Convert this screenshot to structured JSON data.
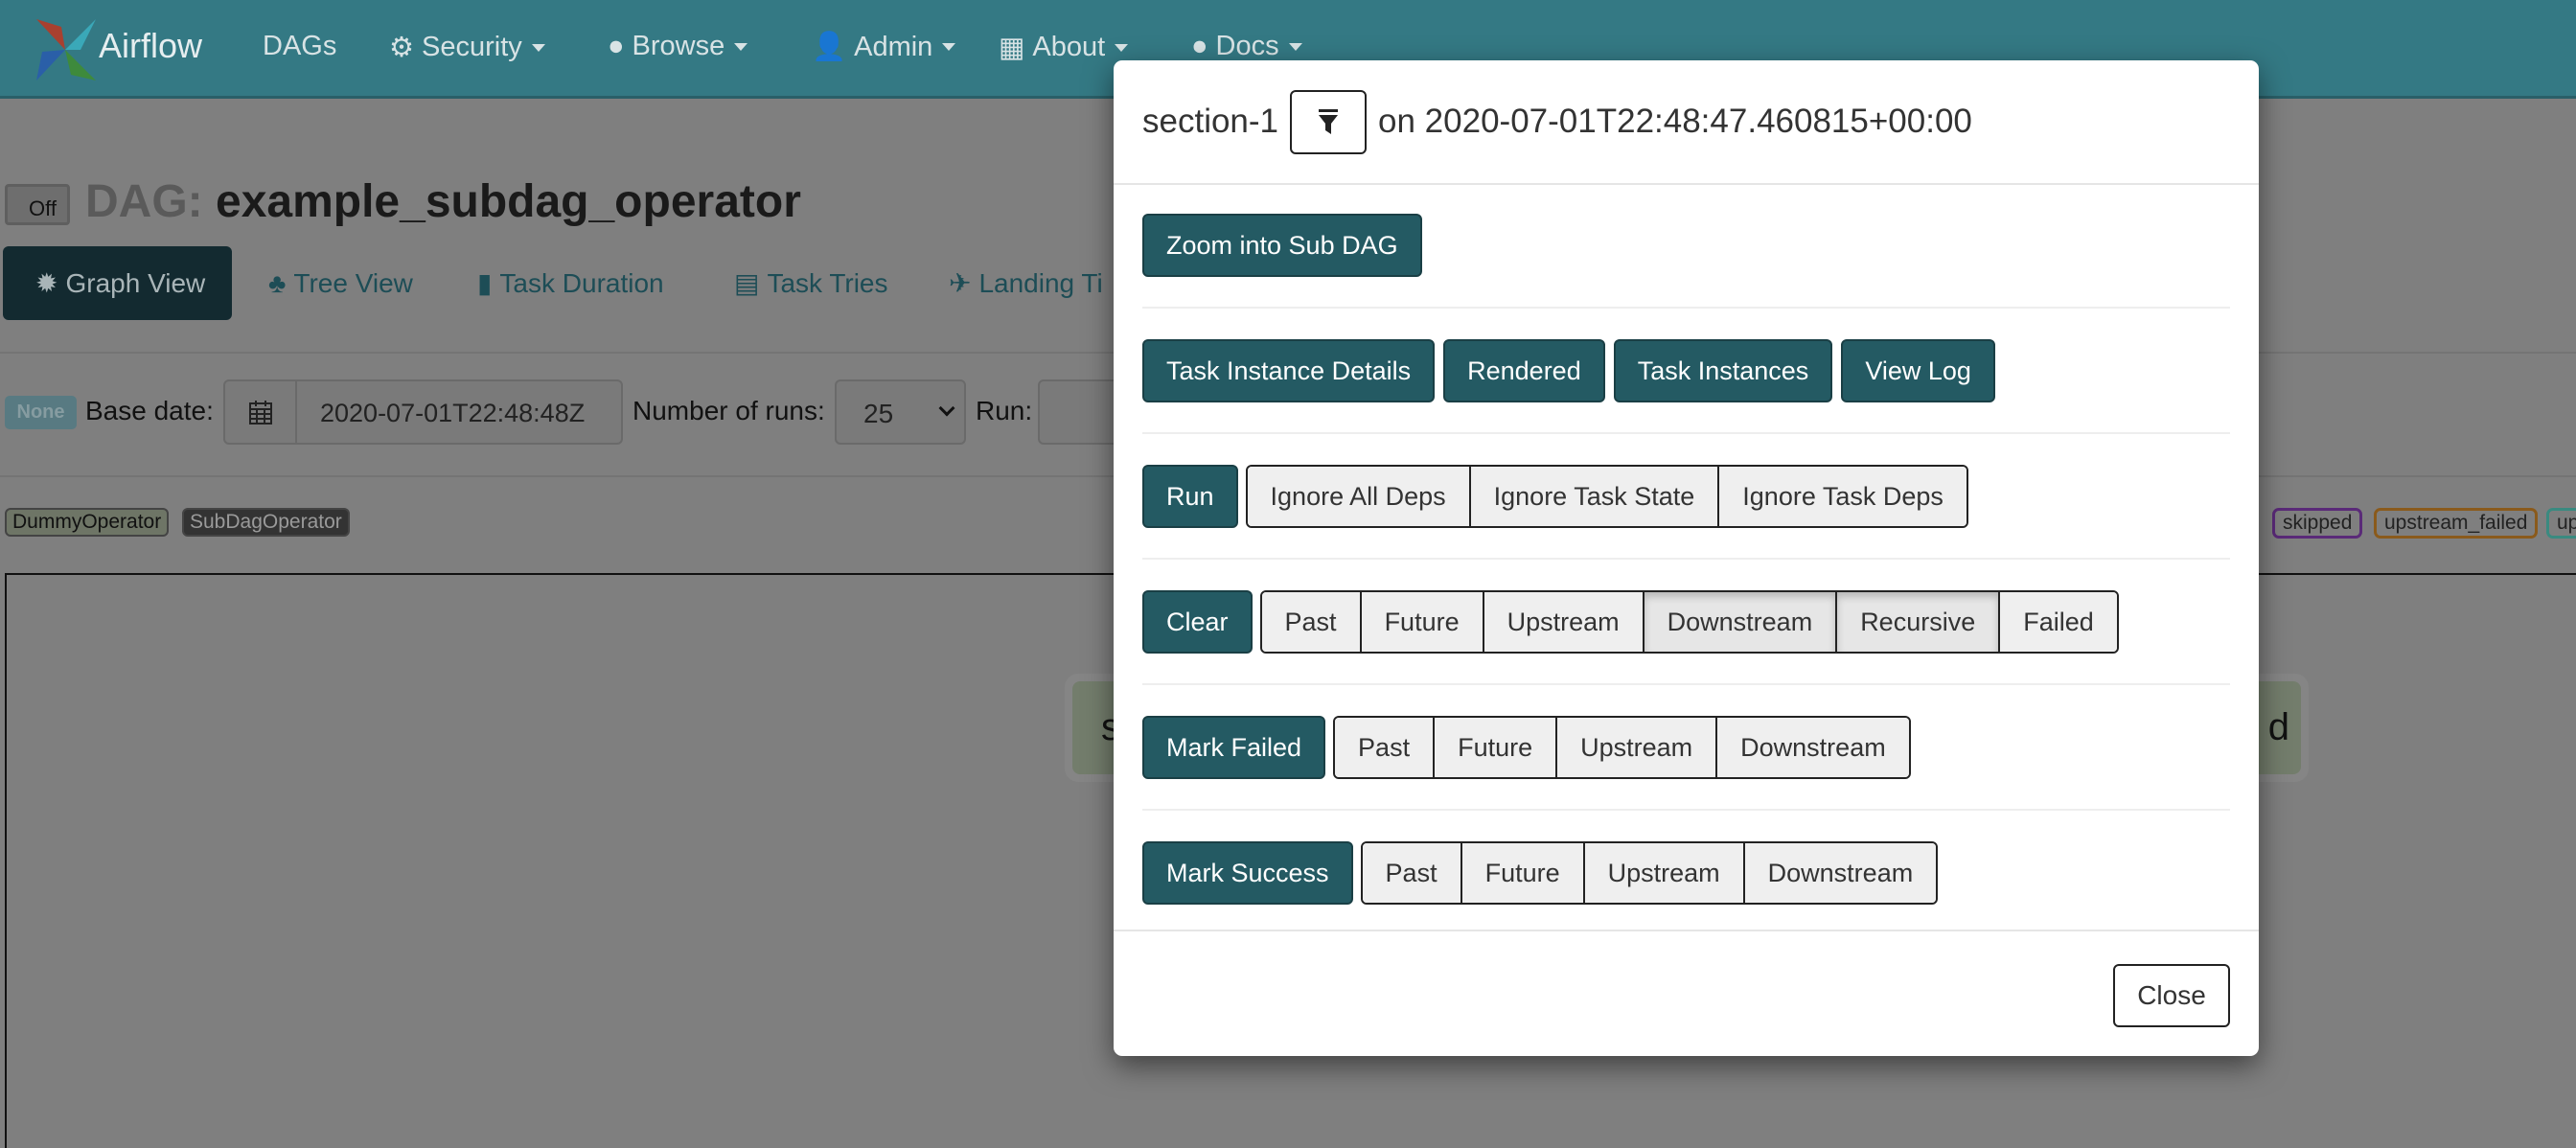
{
  "navbar": {
    "brand": "Airflow",
    "items": [
      {
        "label": "DAGs",
        "icon": ""
      },
      {
        "label": "Security",
        "icon": "gears-icon"
      },
      {
        "label": "Browse",
        "icon": "globe-icon"
      },
      {
        "label": "Admin",
        "icon": "user-icon"
      },
      {
        "label": "About",
        "icon": "grid-icon"
      },
      {
        "label": "Docs",
        "icon": "globe-icon"
      }
    ],
    "color": "#347984"
  },
  "dag": {
    "toggle_label": "Off",
    "prefix": "DAG:",
    "name": "example_subdag_operator"
  },
  "tabs": [
    {
      "label": "Graph View",
      "icon": "sun-icon",
      "active": true
    },
    {
      "label": "Tree View",
      "icon": "tree-icon"
    },
    {
      "label": "Task Duration",
      "icon": "bar-chart-icon"
    },
    {
      "label": "Task Tries",
      "icon": "files-icon"
    },
    {
      "label": "Landing Ti",
      "icon": "plane-icon"
    }
  ],
  "controls": {
    "state_badge": "None",
    "base_date_label": "Base date:",
    "base_date_value": "2020-07-01T22:48:48Z",
    "num_runs_label": "Number of runs:",
    "num_runs_value": "25",
    "run_label": "Run:"
  },
  "operators": [
    "DummyOperator",
    "SubDagOperator"
  ],
  "states": [
    {
      "label": "skipped",
      "color": "#5a2a78"
    },
    {
      "label": "upstream_failed",
      "color": "#8a5a1c"
    },
    {
      "label": "up",
      "color": "#3a8a80"
    }
  ],
  "graph": {
    "node_left_fragment": "s",
    "node_right_fragment": "d"
  },
  "modal": {
    "task_id": "section-1",
    "on_text": "on 2020-07-01T22:48:47.460815+00:00",
    "zoom_subdag": "Zoom into Sub DAG",
    "links": [
      "Task Instance Details",
      "Rendered",
      "Task Instances",
      "View Log"
    ],
    "run": {
      "label": "Run",
      "options": [
        "Ignore All Deps",
        "Ignore Task State",
        "Ignore Task Deps"
      ]
    },
    "clear": {
      "label": "Clear",
      "options": [
        {
          "label": "Past",
          "active": false
        },
        {
          "label": "Future",
          "active": false
        },
        {
          "label": "Upstream",
          "active": false
        },
        {
          "label": "Downstream",
          "active": true
        },
        {
          "label": "Recursive",
          "active": true
        },
        {
          "label": "Failed",
          "active": false
        }
      ]
    },
    "mark_failed": {
      "label": "Mark Failed",
      "options": [
        "Past",
        "Future",
        "Upstream",
        "Downstream"
      ]
    },
    "mark_success": {
      "label": "Mark Success",
      "options": [
        "Past",
        "Future",
        "Upstream",
        "Downstream"
      ]
    },
    "close": "Close",
    "accent": "#245a63"
  }
}
